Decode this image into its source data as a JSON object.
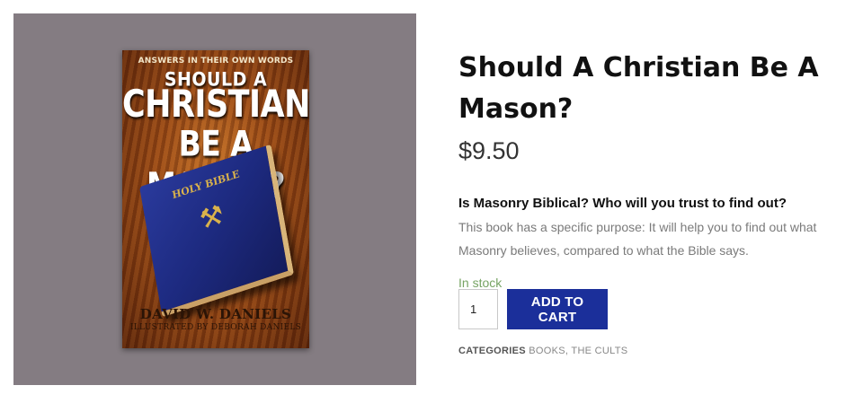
{
  "product": {
    "title": "Should A Christian Be A Mason?",
    "price": "$9.50",
    "description_heading": "Is Masonry Biblical? Who will you trust to find out?",
    "description_body": "This book has a specific purpose: It will help you to find out what Masonry believes, compared to what the Bible says.",
    "stock_status": "In stock",
    "quantity": "1",
    "add_to_cart_label": "ADD TO CART",
    "categories_label": "CATEGORIES",
    "categories": [
      "BOOKS",
      "THE CULTS"
    ],
    "category_separator": ", "
  },
  "cover": {
    "tagline": "ANSWERS IN THEIR OWN WORDS",
    "title_line1": "SHOULD A",
    "title_line2": "CHRISTIAN",
    "title_line3": "BE A MASON?",
    "bible_label": "HOLY BIBLE",
    "emblem": "⚒",
    "author": "DAVID W. DANIELS",
    "illustrator": "ILLUSTRATED BY DEBORAH DANIELS"
  },
  "colors": {
    "image_panel_bg": "#847c82",
    "button_bg": "#1b2f9a",
    "stock_green": "#77a464"
  }
}
